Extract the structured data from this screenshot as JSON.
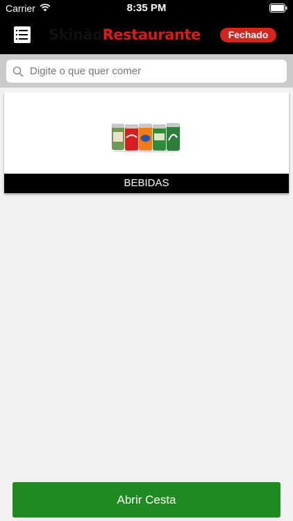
{
  "status_bar": {
    "carrier": "Carrier",
    "time": "8:35 PM",
    "wifi_icon": "wifi-icon",
    "battery_icon": "battery-icon"
  },
  "header": {
    "menu_icon": "list-menu-icon",
    "logo_part1": "Skinão",
    "logo_part2": "Restaurante",
    "status_badge": "Fechado",
    "colors": {
      "background": "#000000",
      "badge": "#d3261c",
      "logo_red": "#e01818"
    }
  },
  "search": {
    "placeholder": "Digite o que quer comer",
    "value": "",
    "icon": "search-icon"
  },
  "categories": [
    {
      "label": "BEBIDAS",
      "image": "soda-cans-image"
    }
  ],
  "footer": {
    "open_cart_label": "Abrir Cesta",
    "button_color": "#1e8a1f"
  }
}
